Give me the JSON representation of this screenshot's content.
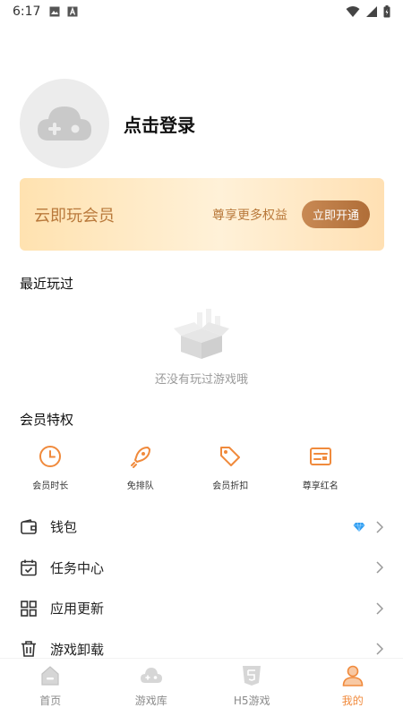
{
  "status_bar": {
    "time": "6:17"
  },
  "profile": {
    "login_label": "点击登录"
  },
  "vip_card": {
    "title": "云即玩会员",
    "subtitle": "尊享更多权益",
    "button_label": "立即开通"
  },
  "recent": {
    "title": "最近玩过",
    "empty_text": "还没有玩过游戏哦"
  },
  "perks": {
    "title": "会员特权",
    "items": [
      {
        "label": "会员时长",
        "icon": "clock-icon"
      },
      {
        "label": "免排队",
        "icon": "rocket-icon"
      },
      {
        "label": "会员折扣",
        "icon": "tag-icon"
      },
      {
        "label": "尊享红名",
        "icon": "id-card-icon"
      }
    ]
  },
  "menu": {
    "items": [
      {
        "label": "钱包",
        "icon": "wallet-icon"
      },
      {
        "label": "任务中心",
        "icon": "calendar-check-icon"
      },
      {
        "label": "应用更新",
        "icon": "grid-icon"
      },
      {
        "label": "游戏卸载",
        "icon": "trash-icon"
      }
    ]
  },
  "tabbar": {
    "items": [
      {
        "label": "首页"
      },
      {
        "label": "游戏库"
      },
      {
        "label": "H5游戏"
      },
      {
        "label": "我的"
      }
    ]
  },
  "colors": {
    "accent": "#f08a3c",
    "vip_text": "#b9793b",
    "muted": "#9a9a9a"
  }
}
